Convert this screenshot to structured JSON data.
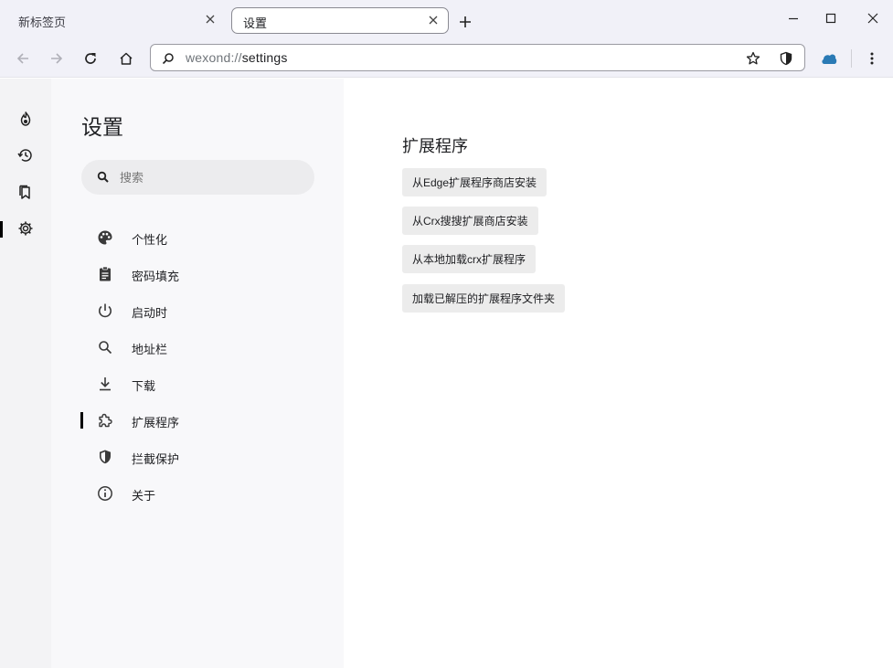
{
  "tabs": [
    {
      "title": "新标签页",
      "active": false
    },
    {
      "title": "设置",
      "active": true
    }
  ],
  "omnibox": {
    "scheme": "wexond://",
    "path": "settings"
  },
  "rail": {
    "items": [
      {
        "icon": "fire-icon"
      },
      {
        "icon": "history-icon"
      },
      {
        "icon": "bookmarks-icon"
      },
      {
        "icon": "gear-icon",
        "active": true
      }
    ]
  },
  "sidebar": {
    "title": "设置",
    "search_placeholder": "搜索",
    "items": [
      {
        "label": "个性化",
        "icon": "palette-icon"
      },
      {
        "label": "密码填充",
        "icon": "clipboard-icon"
      },
      {
        "label": "启动时",
        "icon": "power-icon"
      },
      {
        "label": "地址栏",
        "icon": "search-icon"
      },
      {
        "label": "下载",
        "icon": "download-icon"
      },
      {
        "label": "扩展程序",
        "icon": "puzzle-icon",
        "active": true
      },
      {
        "label": "拦截保护",
        "icon": "shield-icon"
      },
      {
        "label": "关于",
        "icon": "info-icon"
      }
    ]
  },
  "main": {
    "section_title": "扩展程序",
    "buttons": [
      "从Edge扩展程序商店安装",
      "从Crx搜搜扩展商店安装",
      "从本地加载crx扩展程序",
      "加载已解压的扩展程序文件夹"
    ]
  },
  "colors": {
    "chrome_bg": "#f1f1f8",
    "sidebar_bg": "#f8f8fa",
    "rail_bg": "#f3f3f5",
    "button_bg": "#ececec",
    "extension_icon": "#2a7ab5"
  }
}
